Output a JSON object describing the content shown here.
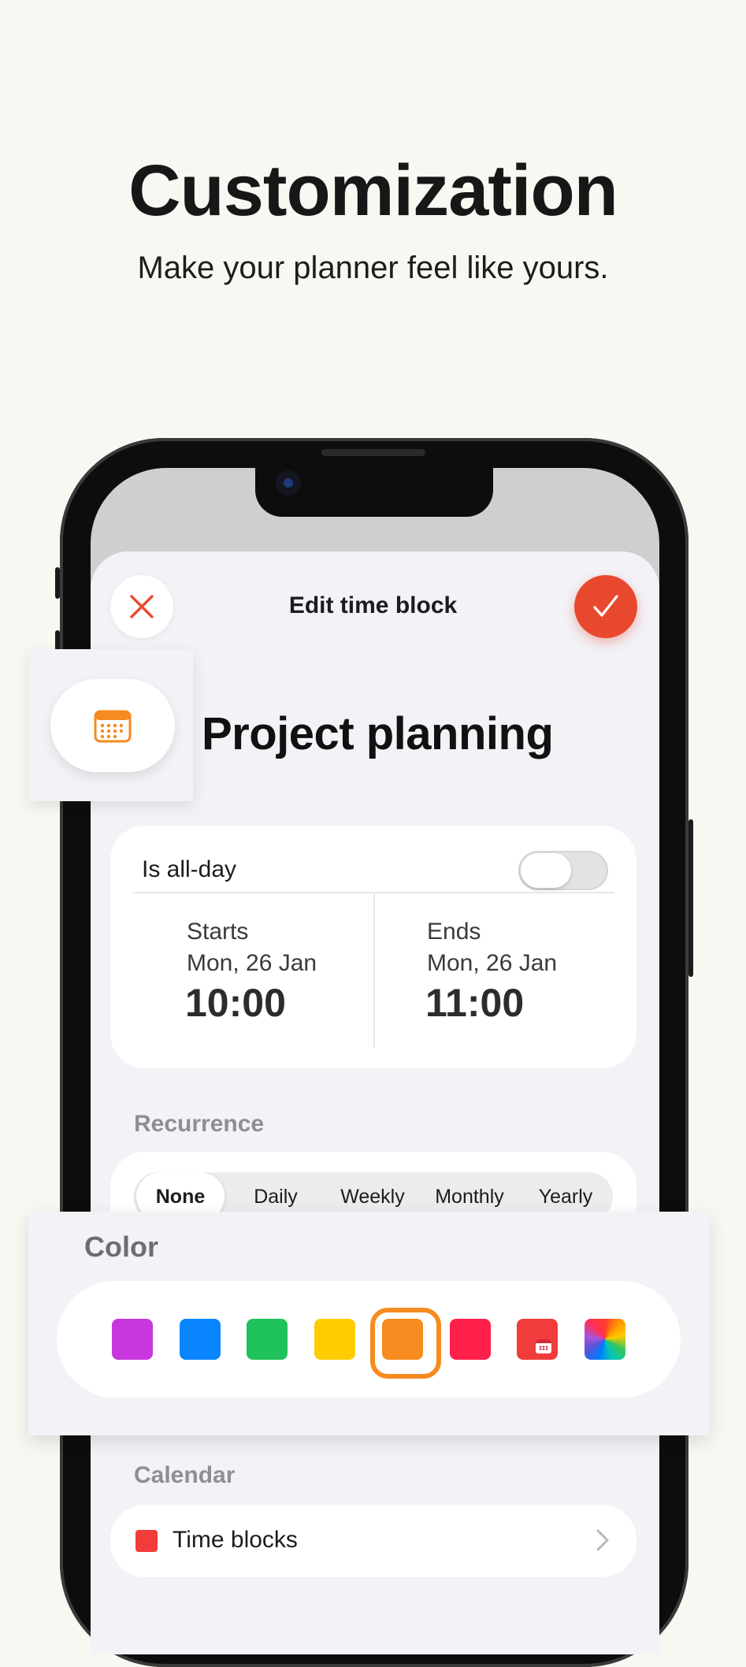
{
  "hero": {
    "title": "Customization",
    "subtitle": "Make your planner feel like yours."
  },
  "sheet": {
    "title": "Edit time block",
    "close_icon": "close-icon",
    "confirm_icon": "checkmark-icon"
  },
  "event": {
    "title": "Project planning",
    "icon": "calendar-icon",
    "icon_color": "#f68b1f"
  },
  "dates": {
    "all_day_label": "Is all-day",
    "all_day_on": false,
    "start_label": "Starts",
    "start_date": "Mon, 26 Jan",
    "start_time": "10:00",
    "end_label": "Ends",
    "end_date": "Mon, 26 Jan",
    "end_time": "11:00"
  },
  "recurrence": {
    "label": "Recurrence",
    "options": [
      "None",
      "Daily",
      "Weekly",
      "Monthly",
      "Yearly"
    ],
    "selected": "None"
  },
  "color": {
    "label": "Color",
    "swatches": [
      {
        "name": "purple",
        "hex": "#c837dd"
      },
      {
        "name": "blue",
        "hex": "#0a84ff"
      },
      {
        "name": "green",
        "hex": "#1fc15a"
      },
      {
        "name": "yellow",
        "hex": "#ffcc00"
      },
      {
        "name": "orange",
        "hex": "#f68b1f"
      },
      {
        "name": "red",
        "hex": "#ff1f4b"
      },
      {
        "name": "calendar",
        "hex": "#f23b3b"
      },
      {
        "name": "custom",
        "hex": "rainbow"
      }
    ],
    "selected": "orange"
  },
  "calendar": {
    "label": "Calendar",
    "name": "Time blocks",
    "color": "#f23b3b"
  },
  "accent": "#e8492e"
}
